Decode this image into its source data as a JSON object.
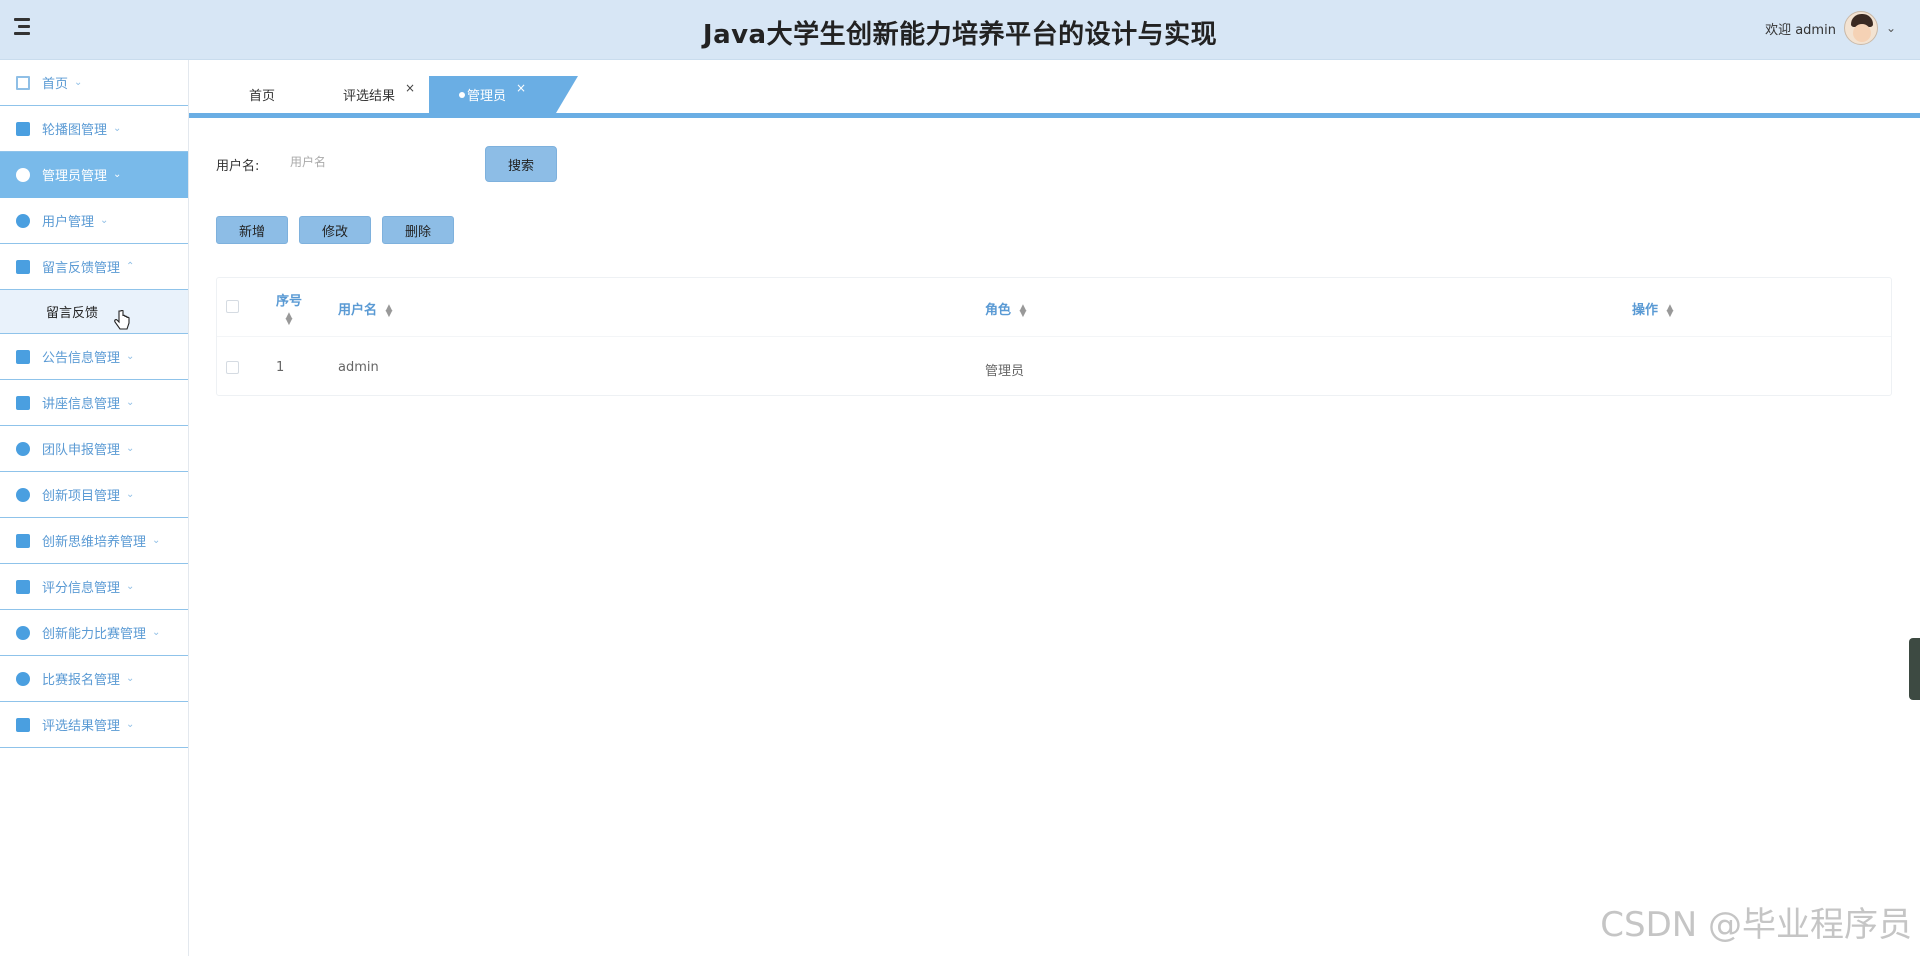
{
  "header": {
    "title": "Java大学生创新能力培养平台的设计与实现",
    "welcome": "欢迎 admin",
    "user_caret": "⌄"
  },
  "sidebar": {
    "items": [
      {
        "label": "首页",
        "icon": "home-icon",
        "chevron": "⌄"
      },
      {
        "label": "轮播图管理",
        "icon": "carousel-icon",
        "chevron": "⌄"
      },
      {
        "label": "管理员管理",
        "icon": "grid-icon",
        "chevron": "⌄",
        "active": true
      },
      {
        "label": "用户管理",
        "icon": "user-icon",
        "chevron": "⌄"
      },
      {
        "label": "留言反馈管理",
        "icon": "message-icon",
        "chevron": "⌃"
      },
      {
        "label": "公告信息管理",
        "icon": "crop-icon",
        "chevron": "⌄"
      },
      {
        "label": "讲座信息管理",
        "icon": "picture-icon",
        "chevron": "⌄"
      },
      {
        "label": "团队申报管理",
        "icon": "team-icon",
        "chevron": "⌄"
      },
      {
        "label": "创新项目管理",
        "icon": "mouse-icon",
        "chevron": "⌄"
      },
      {
        "label": "创新思维培养管理",
        "icon": "mail-icon",
        "chevron": "⌄"
      },
      {
        "label": "评分信息管理",
        "icon": "windows-icon",
        "chevron": "⌄"
      },
      {
        "label": "创新能力比赛管理",
        "icon": "check-circle-icon",
        "chevron": "⌄"
      },
      {
        "label": "比赛报名管理",
        "icon": "drop-icon",
        "chevron": "⌄"
      },
      {
        "label": "评选结果管理",
        "icon": "table-icon",
        "chevron": "⌄"
      }
    ],
    "subitem": "留言反馈"
  },
  "tabs": [
    {
      "label": "首页",
      "closable": false
    },
    {
      "label": "评选结果",
      "close": "×"
    },
    {
      "label": "管理员",
      "close": "×",
      "active": true
    }
  ],
  "search": {
    "label": "用户名:",
    "placeholder": "用户名",
    "button": "搜索"
  },
  "actions": {
    "add": "新增",
    "edit": "修改",
    "delete": "删除"
  },
  "table": {
    "columns": [
      "序号",
      "用户名",
      "角色",
      "操作"
    ],
    "rows": [
      {
        "index": "1",
        "username": "admin",
        "role": "管理员"
      }
    ]
  },
  "watermark": "CSDN @毕业程序员",
  "colors": {
    "header_bg": "#d7e6f5",
    "accent": "#6aaee4",
    "button": "#8dbde6",
    "sidebar_active": "#79baea"
  }
}
